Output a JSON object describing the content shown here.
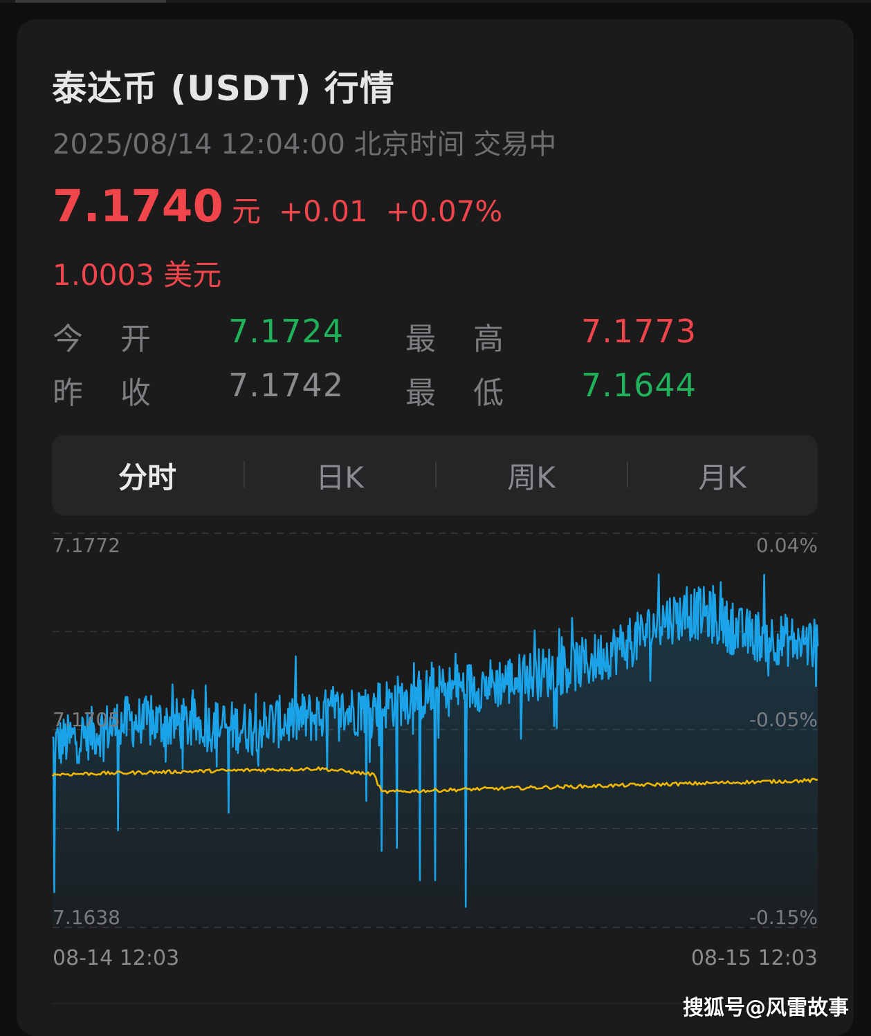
{
  "header": {
    "title": "泰达币 (USDT) 行情",
    "timestamp": "2025/08/14 12:04:00 北京时间 交易中"
  },
  "quote": {
    "price": "7.1740",
    "unit": "元",
    "change": "+0.01",
    "change_pct": "+0.07%",
    "usd_value": "1.0003 美元"
  },
  "stats": {
    "open_label": "今开",
    "open_value": "7.1724",
    "prev_close_label": "昨收",
    "prev_close_value": "7.1742",
    "high_label": "最高",
    "high_value": "7.1773",
    "low_label": "最低",
    "low_value": "7.1644"
  },
  "tabs": [
    "分时",
    "日K",
    "周K",
    "月K"
  ],
  "active_tab": "分时",
  "colors": {
    "up": "#f0454b",
    "down": "#1fb25a",
    "neutral": "#8a8a8f",
    "price_line": "#1aa3e8",
    "avg_line": "#f2b705"
  },
  "chart_data": {
    "type": "line",
    "y_left_ticks": [
      "7.1772",
      "7.1705",
      "7.1638"
    ],
    "y_right_ticks": [
      "0.04%",
      "-0.05%",
      "-0.15%"
    ],
    "x_ticks": [
      "08-14 12:03",
      "08-15 12:03"
    ],
    "ylim": [
      7.1638,
      7.1772
    ],
    "series": [
      {
        "role": "price",
        "x_start": "08-14 12:03",
        "x_end": "08-15 12:03",
        "anchors": [
          [
            0.0,
            7.17
          ],
          [
            0.1,
            7.1708
          ],
          [
            0.25,
            7.1706
          ],
          [
            0.4,
            7.1712
          ],
          [
            0.5,
            7.1718
          ],
          [
            0.6,
            7.1722
          ],
          [
            0.7,
            7.1728
          ],
          [
            0.77,
            7.1737
          ],
          [
            0.8,
            7.1743
          ],
          [
            0.85,
            7.1745
          ],
          [
            0.9,
            7.1738
          ],
          [
            1.0,
            7.1734
          ]
        ],
        "dips": [
          [
            0.002,
            7.165
          ],
          [
            0.085,
            7.1671
          ],
          [
            0.23,
            7.1677
          ],
          [
            0.41,
            7.1681
          ],
          [
            0.43,
            7.1664
          ],
          [
            0.45,
            7.1665
          ],
          [
            0.48,
            7.1654
          ],
          [
            0.5,
            7.1654
          ],
          [
            0.54,
            7.1645
          ]
        ]
      },
      {
        "role": "average",
        "anchors": [
          [
            0.0,
            7.169
          ],
          [
            0.35,
            7.1692
          ],
          [
            0.42,
            7.169
          ],
          [
            0.43,
            7.1684
          ],
          [
            0.55,
            7.1685
          ],
          [
            1.0,
            7.1688
          ]
        ]
      }
    ]
  },
  "footer": {
    "watermark": "搜狐号@风雷故事"
  }
}
